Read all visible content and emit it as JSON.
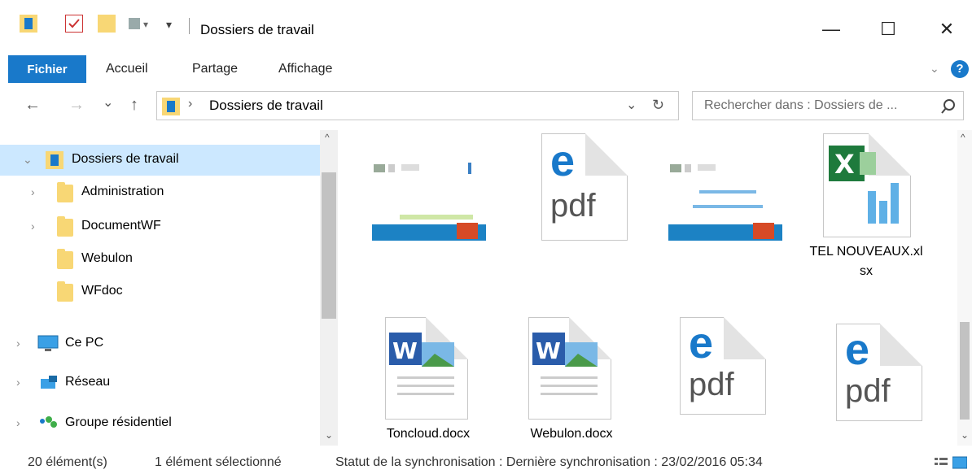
{
  "window": {
    "title": "Dossiers de travail",
    "minimize": "—",
    "maximize": "☐",
    "close": "✕"
  },
  "ribbon": {
    "tabs": [
      "Fichier",
      "Accueil",
      "Partage",
      "Affichage"
    ],
    "help": "?"
  },
  "address": {
    "back": "←",
    "forward": "→",
    "recent": "⌄",
    "up": "↑",
    "path": "Dossiers de travail",
    "separator": "›",
    "dropdown": "⌄",
    "refresh": "↻",
    "search_placeholder": "Rechercher dans : Dossiers de ..."
  },
  "nav": {
    "root": {
      "label": "Dossiers de travail",
      "expanded": true
    },
    "folders": [
      {
        "label": "Administration",
        "expandable": true
      },
      {
        "label": "DocumentWF",
        "expandable": true
      },
      {
        "label": "Webulon",
        "expandable": false
      },
      {
        "label": "WFdoc",
        "expandable": false
      }
    ],
    "this_pc": "Ce PC",
    "network": "Réseau",
    "homegroup": "Groupe résidentiel"
  },
  "files": [
    {
      "type": "pptx-thumb",
      "caption": ""
    },
    {
      "type": "pdf",
      "caption": "",
      "glyph": "e",
      "text": "pdf"
    },
    {
      "type": "pptx-thumb",
      "caption": ""
    },
    {
      "type": "xlsx",
      "caption": "TEL NOUVEAUX.xlsx",
      "glyph": "X"
    },
    {
      "type": "docx",
      "caption": "Toncloud.docx",
      "glyph": "W"
    },
    {
      "type": "docx",
      "caption": "Webulon.docx",
      "glyph": "W"
    },
    {
      "type": "pdf",
      "caption": "",
      "glyph": "e",
      "text": "pdf"
    },
    {
      "type": "pdf",
      "caption": "",
      "glyph": "e",
      "text": "pdf"
    }
  ],
  "status": {
    "count": "20 élément(s)",
    "selected": "1 élément sélectionné",
    "sync": "Statut de la synchronisation :  Dernière synchronisation : 23/02/2016 05:34"
  },
  "colors": {
    "accent": "#1979ca",
    "selection": "#cce8ff",
    "folder": "#f8d775"
  }
}
